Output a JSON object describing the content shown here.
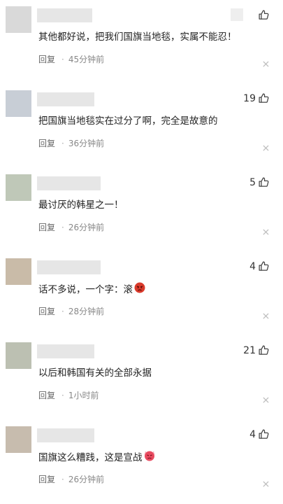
{
  "comments": [
    {
      "avatar_color": "#d9d9d9",
      "username_width_pct": 0.45,
      "likes": "",
      "text": "其他都好说，把我们国旗当地毯，实属不能忍！",
      "reply_label": "回复",
      "separator": "·",
      "time": "45分钟前",
      "emoji": ""
    },
    {
      "avatar_color": "#c8ced6",
      "username_width_pct": 0.5,
      "likes": "19",
      "text": "把国旗当地毯实在过分了啊，完全是故意的",
      "reply_label": "回复",
      "separator": "·",
      "time": "36分钟前",
      "emoji": ""
    },
    {
      "avatar_color": "#bfc8b8",
      "username_width_pct": 0.65,
      "likes": "5",
      "text": "最讨厌的韩星之一！",
      "reply_label": "回复",
      "separator": "·",
      "time": "26分钟前",
      "emoji": ""
    },
    {
      "avatar_color": "#c9bba8",
      "username_width_pct": 0.65,
      "likes": "4",
      "text": "话不多说，一个字：滚",
      "reply_label": "回复",
      "separator": "·",
      "time": "28分钟前",
      "emoji": "angry-face-icon"
    },
    {
      "avatar_color": "#bcc0b2",
      "username_width_pct": 0.5,
      "likes": "21",
      "text": "以后和韩国有关的全部永据",
      "reply_label": "回复",
      "separator": "·",
      "time": "1小时前",
      "emoji": ""
    },
    {
      "avatar_color": "#c7bcae",
      "username_width_pct": 0.5,
      "likes": "4",
      "text": "国旗这么糟践，这是宣战",
      "reply_label": "回复",
      "separator": "·",
      "time": "26分钟前",
      "emoji": "steaming-face-icon"
    }
  ],
  "colors": {
    "thumb_icon": "#444444",
    "angry_emoji": "#d93a2b",
    "steaming_emoji": "#e84a5f"
  }
}
